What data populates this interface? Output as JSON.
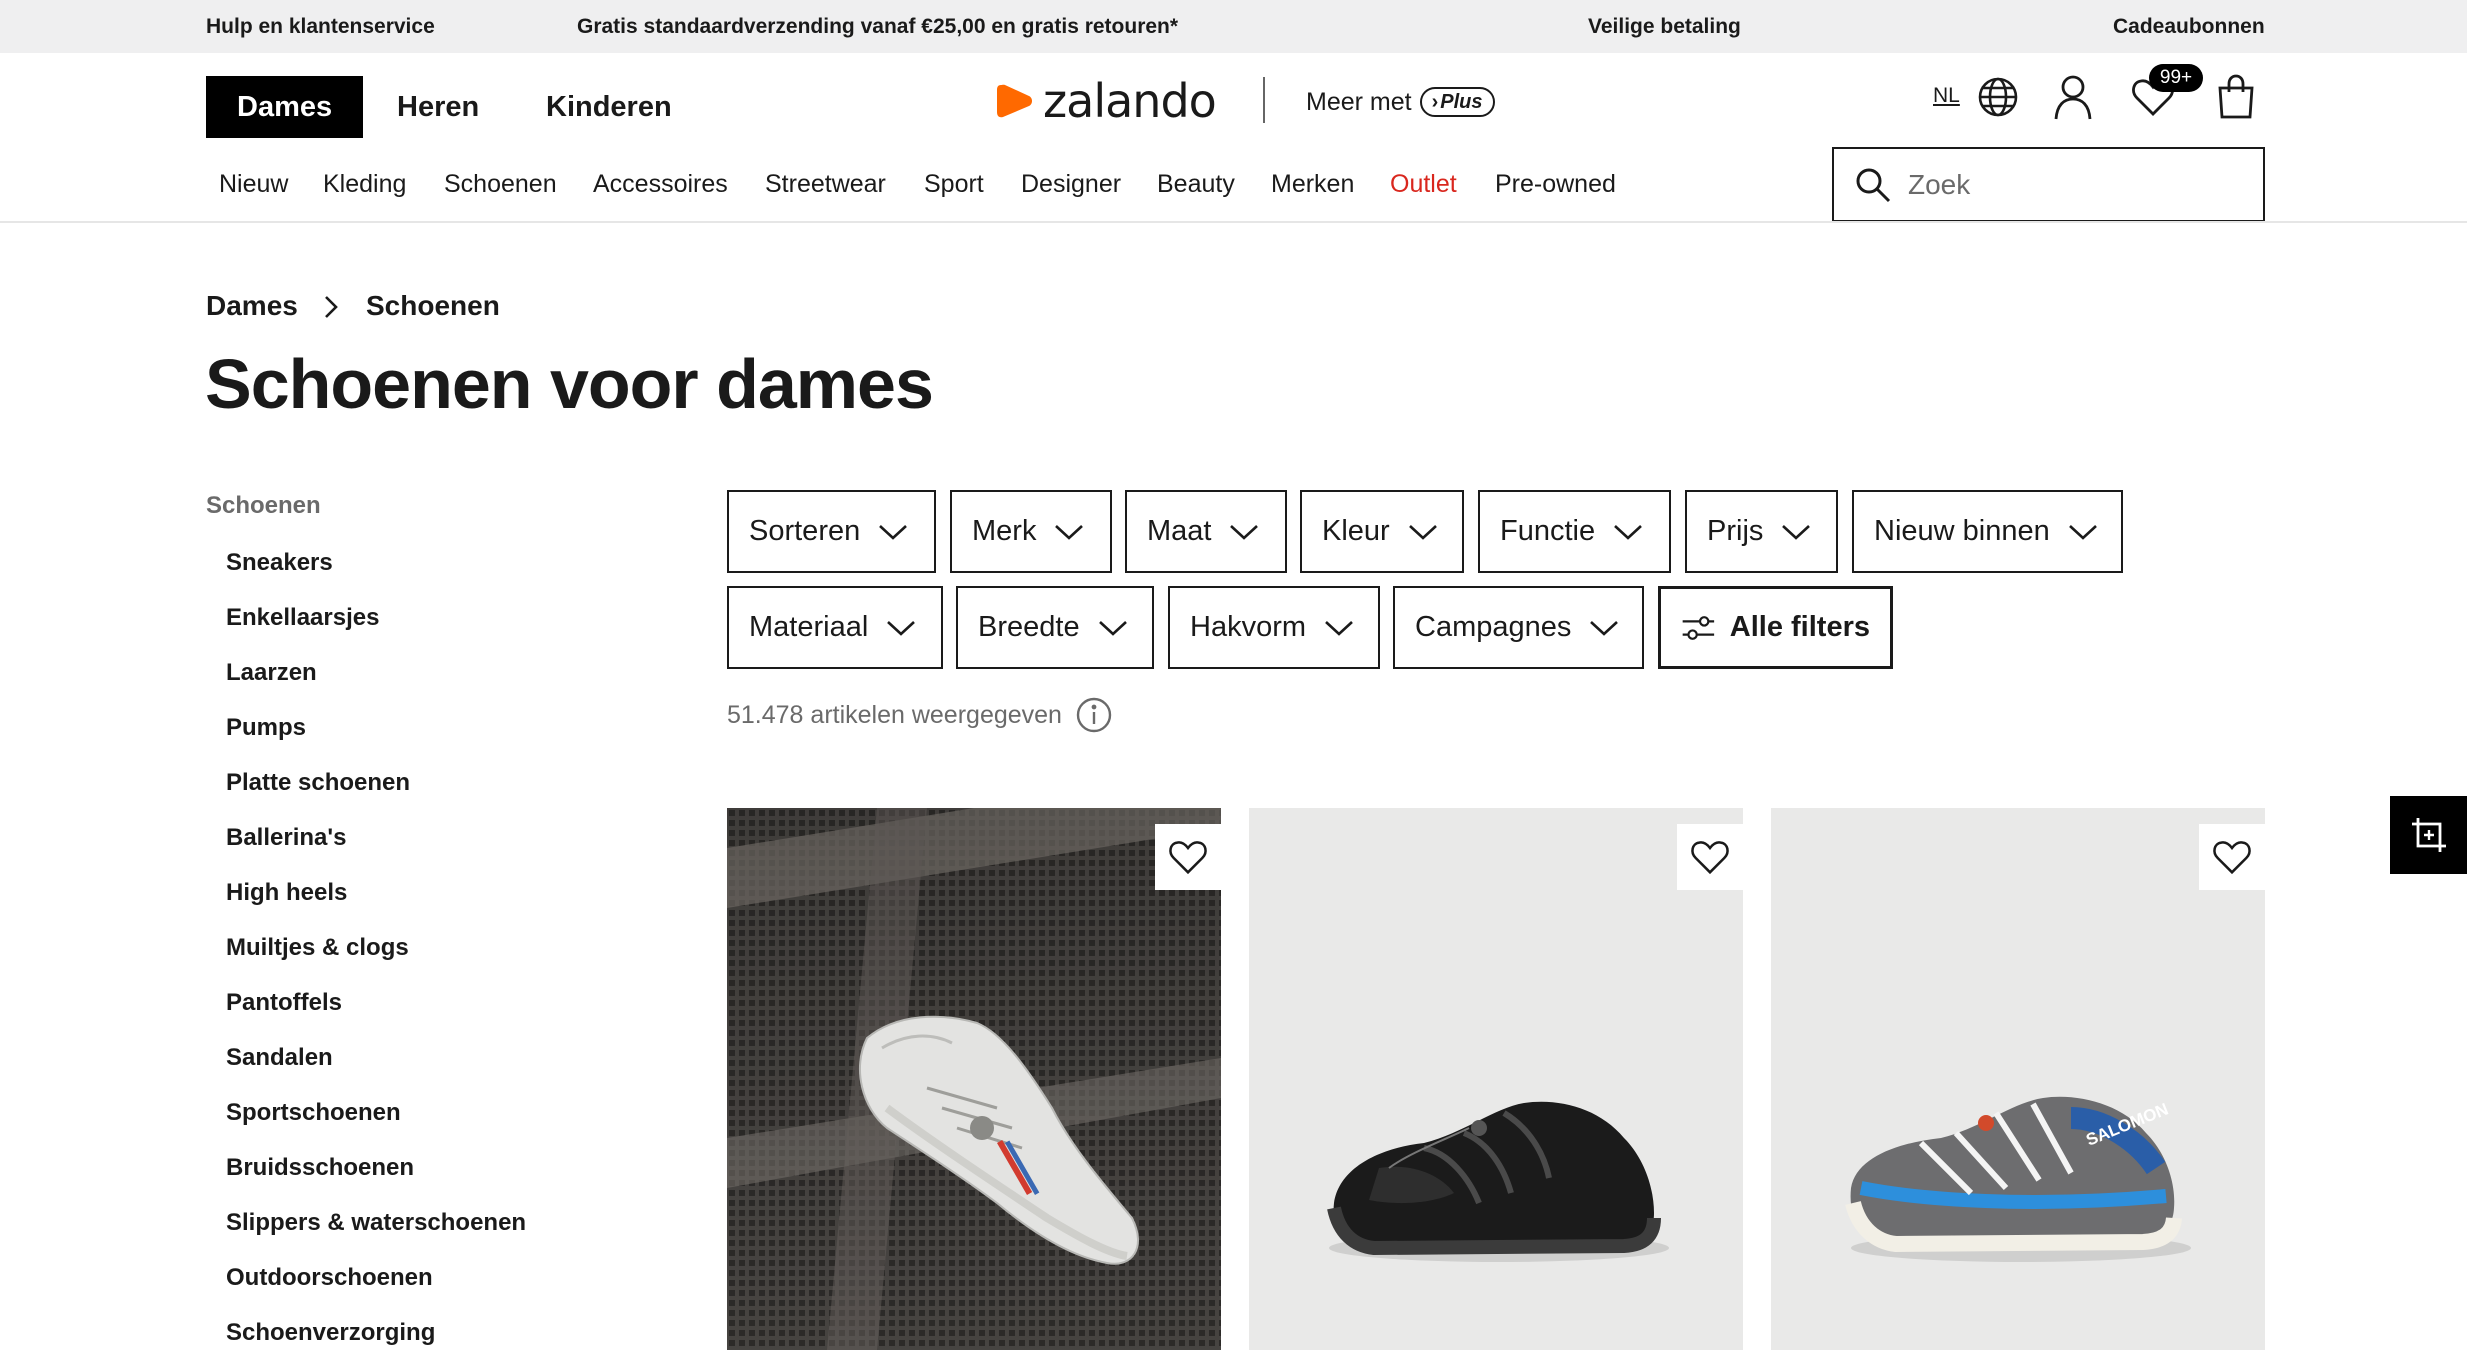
{
  "topbar": {
    "help": "Hulp en klantenservice",
    "shipping": "Gratis standaardverzending vanaf €25,00 en gratis retouren*",
    "payment": "Veilige betaling",
    "giftcards": "Cadeaubonnen"
  },
  "header": {
    "genders": [
      "Dames",
      "Heren",
      "Kinderen"
    ],
    "logo_text": "zalando",
    "meer_met": "Meer met",
    "plus_label": "Plus",
    "language": "NL",
    "wishlist_badge": "99+",
    "brand_color": "#ff6900"
  },
  "nav": {
    "items": [
      "Nieuw",
      "Kleding",
      "Schoenen",
      "Accessoires",
      "Streetwear",
      "Sport",
      "Designer",
      "Beauty",
      "Merken",
      "Outlet",
      "Pre-owned"
    ],
    "outlet_color": "#d9271e"
  },
  "search": {
    "placeholder": "Zoek"
  },
  "breadcrumb": [
    "Dames",
    "Schoenen"
  ],
  "page_title": "Schoenen voor dames",
  "sidebar": {
    "heading": "Schoenen",
    "items": [
      "Sneakers",
      "Enkellaarsjes",
      "Laarzen",
      "Pumps",
      "Platte schoenen",
      "Ballerina's",
      "High heels",
      "Muiltjes & clogs",
      "Pantoffels",
      "Sandalen",
      "Sportschoenen",
      "Bruidsschoenen",
      "Slippers & waterschoenen",
      "Outdoorschoenen",
      "Schoenverzorging"
    ]
  },
  "filters": {
    "row1": [
      "Sorteren",
      "Merk",
      "Maat",
      "Kleur",
      "Functie",
      "Prijs",
      "Nieuw binnen"
    ],
    "row2": [
      "Materiaal",
      "Breedte",
      "Hakvorm",
      "Campagnes"
    ],
    "all_filters": "Alle filters"
  },
  "results_count": "51.478 artikelen weergegeven",
  "products": [
    {
      "image": "white-sneaker-on-metal-grid",
      "wishlist_icon": "heart-icon"
    },
    {
      "image": "black-sneaker",
      "wishlist_icon": "heart-icon"
    },
    {
      "image": "grey-blue-salomon-sneaker",
      "wishlist_icon": "heart-icon",
      "shoe_text": "SALOMON"
    }
  ]
}
